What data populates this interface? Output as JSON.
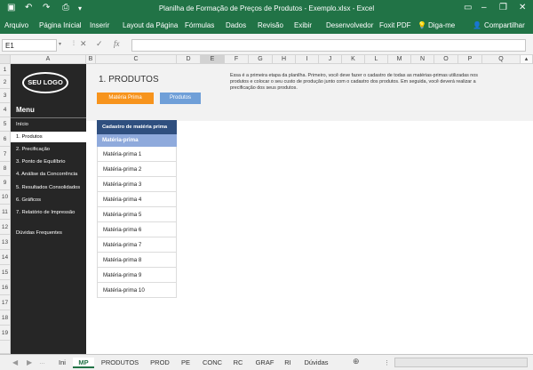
{
  "window": {
    "title": "Planilha de Formação de Preços de Produtos - Exemplo.xlsx - Excel"
  },
  "ribbon": {
    "tabs": [
      "Arquivo",
      "Página Inicial",
      "Inserir",
      "Layout da Página",
      "Fórmulas",
      "Dados",
      "Revisão",
      "Exibir",
      "Desenvolvedor",
      "Foxit PDF"
    ],
    "tell_me": "Diga-me",
    "share": "Compartilhar"
  },
  "formula_bar": {
    "name_box": "E1",
    "fx": "fx"
  },
  "columns": [
    "A",
    "B",
    "C",
    "D",
    "E",
    "F",
    "G",
    "H",
    "I",
    "J",
    "K",
    "L",
    "M",
    "N",
    "O",
    "P",
    "Q"
  ],
  "rows": [
    "1",
    "2",
    "3",
    "4",
    "5",
    "6",
    "7",
    "8",
    "9",
    "10",
    "11",
    "12",
    "13",
    "14",
    "15",
    "16",
    "17",
    "18",
    "19"
  ],
  "sidebar": {
    "logo": "SEU LOGO",
    "menu_title": "Menu",
    "items": [
      "Início",
      "1. Produtos",
      "2. Precificação",
      "3. Ponto de Equilíbrio",
      "4. Análise da Concorrência",
      "5. Resultados Consolidados",
      "6. Gráficos",
      "7. Relatório de Impressão",
      "Dúvidas Frequentes"
    ]
  },
  "page": {
    "title": "1. PRODUTOS",
    "description": "Essa é a primeira etapa da planilha. Primeiro, você deve fazer o cadastro de todas as matérias-primas utilizadas nos produtos e colocar o seu custo de produção junto com o cadastro dos produtos. Em seguida, você deverá realizar a precificação dos seus produtos.",
    "buttons": [
      "Matéria Prima",
      "Produtos"
    ],
    "accent_orange": "#f7941d",
    "accent_blue": "#6f9fd8"
  },
  "table": {
    "header": "Cadastro de matéria prima",
    "subheader": "Matéria-prima",
    "items": [
      "Matéria-prima 1",
      "Matéria-prima 2",
      "Matéria-prima 3",
      "Matéria-prima 4",
      "Matéria-prima 5",
      "Matéria-prima 6",
      "Matéria-prima 7",
      "Matéria-prima 8",
      "Matéria-prima 9",
      "Matéria-prima 10"
    ]
  },
  "sheets": [
    "Ini",
    "MP",
    "PRODUTOS",
    "PROD",
    "PE",
    "CONC",
    "RC",
    "GRAF",
    "RI",
    "Dúvidas"
  ],
  "active_sheet": "MP"
}
